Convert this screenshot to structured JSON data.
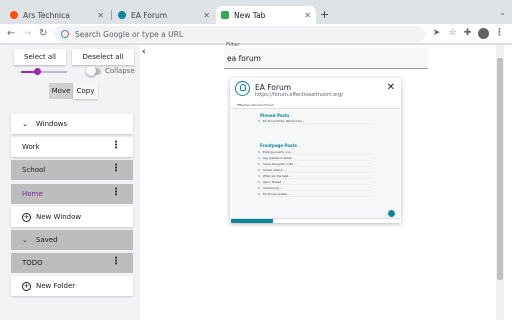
{
  "tabs": [
    {
      "title": "Ars Technica",
      "favicon_color": "#ff4e00"
    },
    {
      "title": "EA Forum",
      "favicon_color": "#0c869b"
    },
    {
      "title": "New Tab",
      "favicon_color": "#34a853",
      "active": true
    }
  ],
  "omnibox": {
    "placeholder": "Search Google or type a URL"
  },
  "sidebar": {
    "select_all": "Select all",
    "deselect_all": "Deselect all",
    "slider_value": 0.35,
    "collapse_label": "Collapse",
    "move_label": "Move",
    "copy_label": "Copy",
    "windows_section": "Windows",
    "windows": [
      {
        "label": "Work"
      },
      {
        "label": "School"
      },
      {
        "label": "Home",
        "accent": "#7b1fa2"
      }
    ],
    "new_window": "New Window",
    "saved_section": "Saved",
    "saved": [
      {
        "label": "TODO"
      }
    ],
    "new_folder": "New Folder"
  },
  "filter": {
    "label": "Filter",
    "value": "ea forum"
  },
  "result": {
    "title": "EA Forum",
    "url": "https://forum.effectivealtruism.org/",
    "thumbnail": {
      "site_name": "Effective Altruism Forum",
      "pinned_heading": "Pinned Posts",
      "pinned": [
        "EA Forum Prize: Winners for..."
      ],
      "frontpage_heading": "Frontpage Posts",
      "frontpage": [
        "Ending poverty one ...",
        "Key questions about ...",
        "Some thoughts on EA ...",
        "Career advice ...",
        "What are the best ...",
        "Open Thread ...",
        "Introducing ...",
        "EA Forum update ..."
      ]
    }
  },
  "colors": {
    "accent": "#9c27b0",
    "ea_teal": "#0c869b"
  }
}
